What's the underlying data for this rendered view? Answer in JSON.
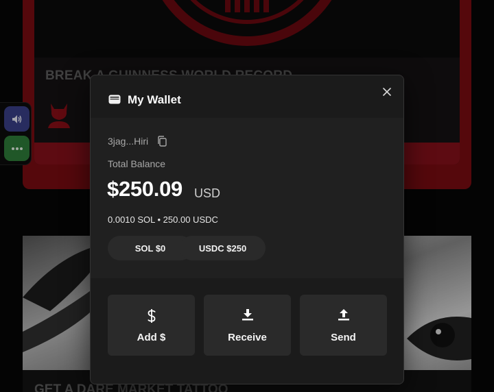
{
  "background": {
    "card1_title": "BREAK A GUINNESS WORLD RECORD",
    "card2_title": "GET A DARE MARKET TATTOO"
  },
  "sidebar": {
    "volume_icon": "volume-icon",
    "more_icon": "more-icon"
  },
  "modal": {
    "title": "My Wallet",
    "close_icon": "close-icon",
    "address": "3jag...Hiri",
    "balance_label": "Total Balance",
    "balance_amount": "$250.09",
    "balance_currency": "USD",
    "holdings": "0.0010 SOL • 250.00 USDC",
    "chips": [
      {
        "label": "SOL $0"
      },
      {
        "label": "USDC $250"
      }
    ],
    "actions": [
      {
        "label": "Add $",
        "icon": "dollar-icon"
      },
      {
        "label": "Receive",
        "icon": "download-icon"
      },
      {
        "label": "Send",
        "icon": "upload-icon"
      }
    ]
  },
  "colors": {
    "brand_red": "#7a0c12",
    "modal_bg": "#1b1b1b",
    "button_bg": "#2a2a2a"
  }
}
